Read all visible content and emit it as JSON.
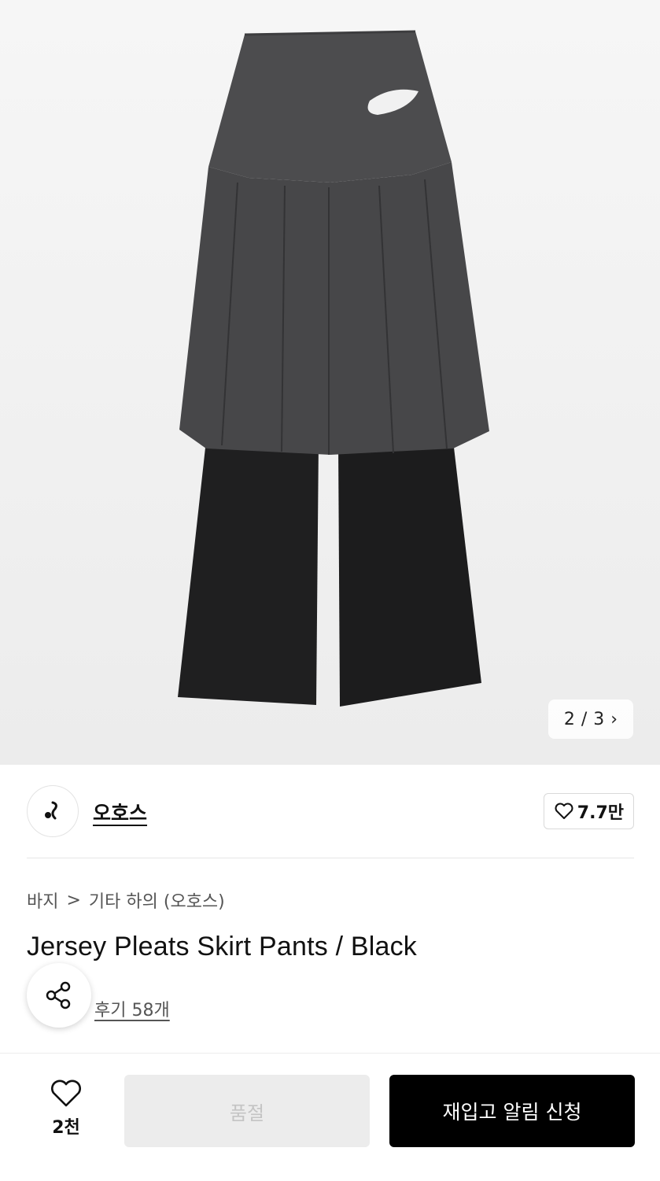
{
  "gallery": {
    "image_name": "product-image",
    "current": "2",
    "separator": "/",
    "total": "3"
  },
  "brand": {
    "logo_glyph": "𝆑",
    "name": "오호스",
    "like_count": "7.7만"
  },
  "breadcrumb": {
    "category": "바지",
    "separator": ">",
    "subcategory": "기타 하의 (오호스)"
  },
  "product": {
    "title": "Jersey Pleats Skirt Pants / Black",
    "reviews": "후기 58개"
  },
  "bottom_bar": {
    "wish_count": "2천",
    "soldout_label": "품절",
    "restock_label": "재입고 알림 신청"
  },
  "colors": {
    "skirt": "#4a4a4c",
    "pants": "#1e1e1f",
    "primary_button": "#000000",
    "disabled_button": "#ececec"
  }
}
